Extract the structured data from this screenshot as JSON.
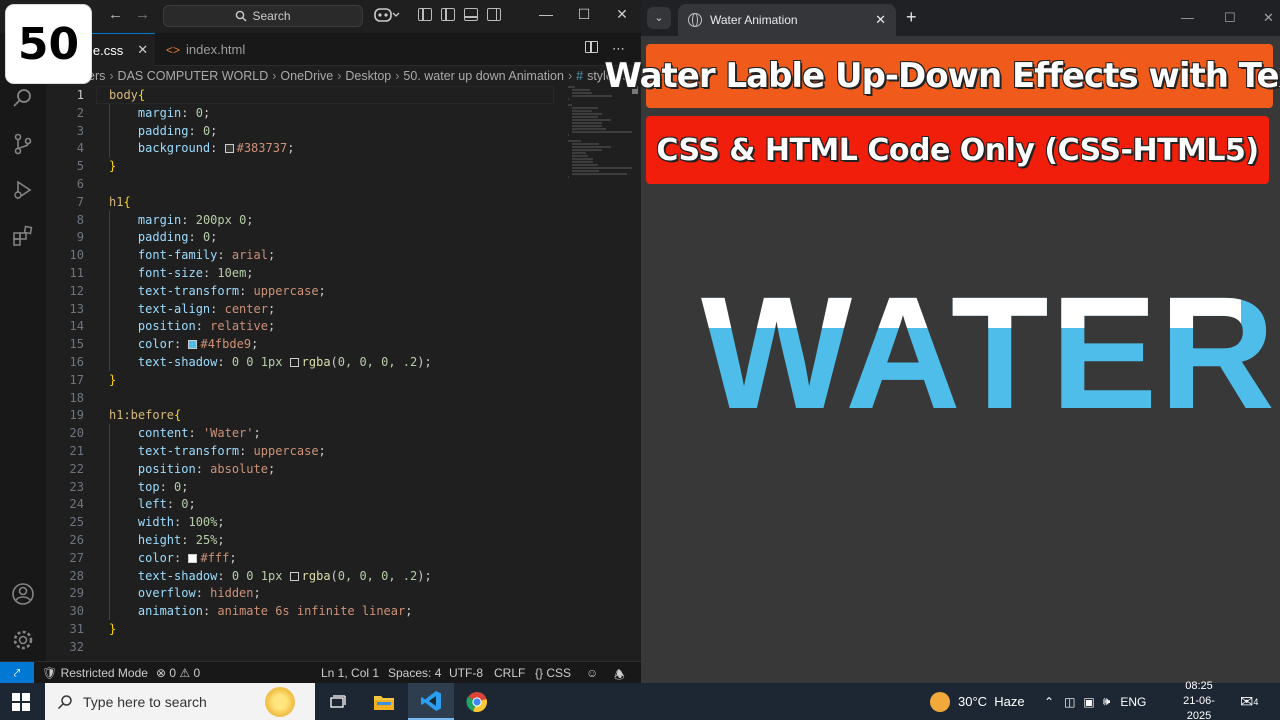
{
  "badge": "50",
  "vscode": {
    "search_label": "Search",
    "tabs": [
      {
        "label": "le.css",
        "active": true
      },
      {
        "label": "index.html",
        "active": false
      }
    ],
    "breadcrumb": [
      "ers",
      "DAS COMPUTER WORLD",
      "OneDrive",
      "Desktop",
      "50. water up down Animation",
      "style.css"
    ],
    "status": {
      "restricted": "Restricted Mode",
      "errors": "0",
      "warnings": "0",
      "position": "Ln 1, Col 1",
      "spaces": "Spaces: 4",
      "encoding": "UTF-8",
      "eol": "CRLF",
      "language": "CSS"
    },
    "code_lines": [
      {
        "n": "1",
        "t": [
          [
            "sel",
            "body"
          ],
          [
            "brace",
            "{"
          ]
        ]
      },
      {
        "n": "2",
        "t": [
          [
            "ind",
            "    "
          ],
          [
            "prop",
            "margin"
          ],
          [
            "punct",
            ": "
          ],
          [
            "num",
            "0"
          ],
          [
            "punct",
            ";"
          ]
        ]
      },
      {
        "n": "3",
        "t": [
          [
            "ind",
            "    "
          ],
          [
            "prop",
            "padding"
          ],
          [
            "punct",
            ": "
          ],
          [
            "num",
            "0"
          ],
          [
            "punct",
            ";"
          ]
        ]
      },
      {
        "n": "4",
        "t": [
          [
            "ind",
            "    "
          ],
          [
            "prop",
            "background"
          ],
          [
            "punct",
            ": "
          ],
          [
            "sw",
            "#383737"
          ],
          [
            "val",
            "#383737"
          ],
          [
            "punct",
            ";"
          ]
        ]
      },
      {
        "n": "5",
        "t": [
          [
            "brace",
            "}"
          ]
        ]
      },
      {
        "n": "6",
        "t": []
      },
      {
        "n": "7",
        "t": [
          [
            "sel",
            "h1"
          ],
          [
            "brace",
            "{"
          ]
        ]
      },
      {
        "n": "8",
        "t": [
          [
            "ind",
            "    "
          ],
          [
            "prop",
            "margin"
          ],
          [
            "punct",
            ": "
          ],
          [
            "num",
            "200px 0"
          ],
          [
            "punct",
            ";"
          ]
        ]
      },
      {
        "n": "9",
        "t": [
          [
            "ind",
            "    "
          ],
          [
            "prop",
            "padding"
          ],
          [
            "punct",
            ": "
          ],
          [
            "num",
            "0"
          ],
          [
            "punct",
            ";"
          ]
        ]
      },
      {
        "n": "10",
        "t": [
          [
            "ind",
            "    "
          ],
          [
            "prop",
            "font-family"
          ],
          [
            "punct",
            ": "
          ],
          [
            "val",
            "arial"
          ],
          [
            "punct",
            ";"
          ]
        ]
      },
      {
        "n": "11",
        "t": [
          [
            "ind",
            "    "
          ],
          [
            "prop",
            "font-size"
          ],
          [
            "punct",
            ": "
          ],
          [
            "num",
            "10em"
          ],
          [
            "punct",
            ";"
          ]
        ]
      },
      {
        "n": "12",
        "t": [
          [
            "ind",
            "    "
          ],
          [
            "prop",
            "text-transform"
          ],
          [
            "punct",
            ": "
          ],
          [
            "val",
            "uppercase"
          ],
          [
            "punct",
            ";"
          ]
        ]
      },
      {
        "n": "13",
        "t": [
          [
            "ind",
            "    "
          ],
          [
            "prop",
            "text-align"
          ],
          [
            "punct",
            ": "
          ],
          [
            "val",
            "center"
          ],
          [
            "punct",
            ";"
          ]
        ]
      },
      {
        "n": "14",
        "t": [
          [
            "ind",
            "    "
          ],
          [
            "prop",
            "position"
          ],
          [
            "punct",
            ": "
          ],
          [
            "val",
            "relative"
          ],
          [
            "punct",
            ";"
          ]
        ]
      },
      {
        "n": "15",
        "t": [
          [
            "ind",
            "    "
          ],
          [
            "prop",
            "color"
          ],
          [
            "punct",
            ": "
          ],
          [
            "sw",
            "#4fbde9"
          ],
          [
            "val",
            "#4fbde9"
          ],
          [
            "punct",
            ";"
          ]
        ]
      },
      {
        "n": "16",
        "t": [
          [
            "ind",
            "    "
          ],
          [
            "prop",
            "text-shadow"
          ],
          [
            "punct",
            ": "
          ],
          [
            "num",
            "0 0 1px "
          ],
          [
            "sw",
            "rgba(0,0,0,.2)"
          ],
          [
            "fn",
            "rgba"
          ],
          [
            "punct",
            "("
          ],
          [
            "num",
            "0, 0, 0, .2"
          ],
          [
            "punct",
            ");"
          ]
        ]
      },
      {
        "n": "17",
        "t": [
          [
            "brace",
            "}"
          ]
        ]
      },
      {
        "n": "18",
        "t": []
      },
      {
        "n": "19",
        "t": [
          [
            "sel",
            "h1:before"
          ],
          [
            "brace",
            "{"
          ]
        ]
      },
      {
        "n": "20",
        "t": [
          [
            "ind",
            "    "
          ],
          [
            "prop",
            "content"
          ],
          [
            "punct",
            ": "
          ],
          [
            "val",
            "'Water'"
          ],
          [
            "punct",
            ";"
          ]
        ]
      },
      {
        "n": "21",
        "t": [
          [
            "ind",
            "    "
          ],
          [
            "prop",
            "text-transform"
          ],
          [
            "punct",
            ": "
          ],
          [
            "val",
            "uppercase"
          ],
          [
            "punct",
            ";"
          ]
        ]
      },
      {
        "n": "22",
        "t": [
          [
            "ind",
            "    "
          ],
          [
            "prop",
            "position"
          ],
          [
            "punct",
            ": "
          ],
          [
            "val",
            "absolute"
          ],
          [
            "punct",
            ";"
          ]
        ]
      },
      {
        "n": "23",
        "t": [
          [
            "ind",
            "    "
          ],
          [
            "prop",
            "top"
          ],
          [
            "punct",
            ": "
          ],
          [
            "num",
            "0"
          ],
          [
            "punct",
            ";"
          ]
        ]
      },
      {
        "n": "24",
        "t": [
          [
            "ind",
            "    "
          ],
          [
            "prop",
            "left"
          ],
          [
            "punct",
            ": "
          ],
          [
            "num",
            "0"
          ],
          [
            "punct",
            ";"
          ]
        ]
      },
      {
        "n": "25",
        "t": [
          [
            "ind",
            "    "
          ],
          [
            "prop",
            "width"
          ],
          [
            "punct",
            ": "
          ],
          [
            "num",
            "100%"
          ],
          [
            "punct",
            ";"
          ]
        ]
      },
      {
        "n": "26",
        "t": [
          [
            "ind",
            "    "
          ],
          [
            "prop",
            "height"
          ],
          [
            "punct",
            ": "
          ],
          [
            "num",
            "25%"
          ],
          [
            "punct",
            ";"
          ]
        ]
      },
      {
        "n": "27",
        "t": [
          [
            "ind",
            "    "
          ],
          [
            "prop",
            "color"
          ],
          [
            "punct",
            ": "
          ],
          [
            "sw",
            "#fff"
          ],
          [
            "val",
            "#fff"
          ],
          [
            "punct",
            ";"
          ]
        ]
      },
      {
        "n": "28",
        "t": [
          [
            "ind",
            "    "
          ],
          [
            "prop",
            "text-shadow"
          ],
          [
            "punct",
            ": "
          ],
          [
            "num",
            "0 0 1px "
          ],
          [
            "sw",
            "rgba(0,0,0,.2)"
          ],
          [
            "fn",
            "rgba"
          ],
          [
            "punct",
            "("
          ],
          [
            "num",
            "0, 0, 0, .2"
          ],
          [
            "punct",
            ");"
          ]
        ]
      },
      {
        "n": "29",
        "t": [
          [
            "ind",
            "    "
          ],
          [
            "prop",
            "overflow"
          ],
          [
            "punct",
            ": "
          ],
          [
            "val",
            "hidden"
          ],
          [
            "punct",
            ";"
          ]
        ]
      },
      {
        "n": "30",
        "t": [
          [
            "ind",
            "    "
          ],
          [
            "prop",
            "animation"
          ],
          [
            "punct",
            ": "
          ],
          [
            "val",
            "animate 6s infinite linear"
          ],
          [
            "punct",
            ";"
          ]
        ]
      },
      {
        "n": "31",
        "t": [
          [
            "brace",
            "}"
          ]
        ]
      },
      {
        "n": "32",
        "t": []
      }
    ]
  },
  "browser": {
    "tab_title": "Water Animation",
    "banner1": "Water Lable Up-Down Effects with Text",
    "banner2": "CSS & HTML Code Only (CSS-HTML5)",
    "water_text": "WATER",
    "colors": {
      "water": "#4fbde9",
      "background": "#383737",
      "banner1": "#f05a1a",
      "banner2": "#f01e0a"
    }
  },
  "taskbar": {
    "search_placeholder": "Type here to search",
    "weather": "30°C  Haze",
    "lang": "ENG",
    "time": "08:25",
    "date": "21-06-2025",
    "notifications": "4"
  }
}
